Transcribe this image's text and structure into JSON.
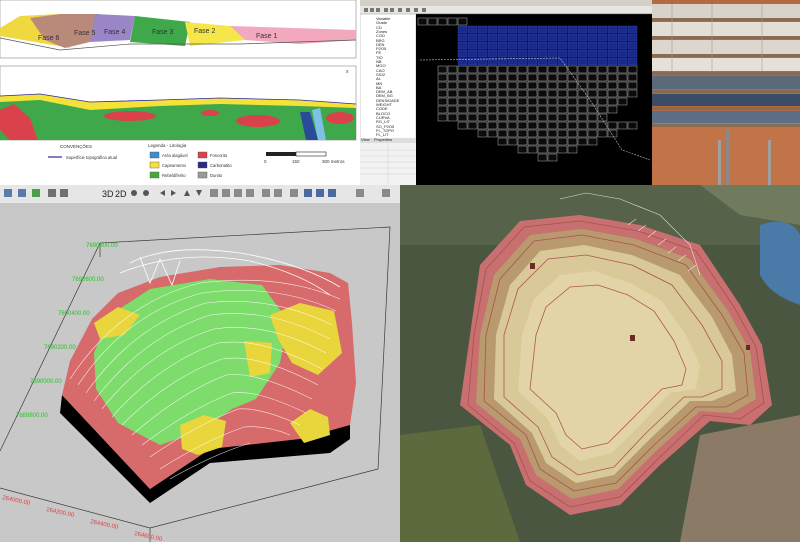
{
  "sections": {
    "phases": [
      "Fase 6",
      "Fase 5",
      "Fase 4",
      "Fase 3",
      "Fase 2",
      "Fase 1"
    ],
    "legend_title": "Legenda - Litologia",
    "conventions_title": "CONVENÇÕES",
    "surface_label": "Superfície topográfica atual",
    "lithology": [
      {
        "label": "Aréa alagável",
        "color": "#3a8fd0"
      },
      {
        "label": "Capeamento",
        "color": "#f4e23a"
      },
      {
        "label": "Rebeldíferito",
        "color": "#47a83c"
      },
      {
        "label": "Foscorito",
        "color": "#d9424a"
      },
      {
        "label": "Carbonatito",
        "color": "#2a2a8a"
      },
      {
        "label": "Dunito",
        "color": "#9a9a9a"
      }
    ],
    "scale": {
      "zero": "0",
      "mid": "150",
      "end": "300 metros"
    },
    "close_mark": "x"
  },
  "block_model": {
    "window": "block-model-software",
    "tree_items": [
      "Variable",
      "Grade",
      "CD",
      "Zones",
      "COD",
      "BRG",
      "DEN",
      "P2O5",
      "FE",
      "TIO",
      "NB",
      "MGO",
      "CAO",
      "SIO2",
      "AL",
      "MN",
      "BA",
      "DEM_AB",
      "DEM_BG",
      "DENSIDADE",
      "WEIGHT",
      "CODE",
      "BLOCO",
      "CURVA",
      "RG_LIT",
      "SO_P2O5",
      "FL_TOPO",
      "FL_LIT"
    ],
    "footer_tabs": [
      "View",
      "Properties"
    ]
  },
  "viewer3d": {
    "toolbar": [
      "3D",
      "2D"
    ],
    "coordinates_red": [
      "264000.00",
      "264200.00",
      "264400.00",
      "264600.00",
      "264800.00"
    ],
    "coordinates_green": [
      "7690800.00",
      "7690600.00",
      "7690400.00",
      "7690200.00",
      "7690000.00",
      "7689800.00"
    ]
  },
  "colors": {
    "fase6": "#f0d840",
    "fase5": "#b98a7a",
    "fase4": "#9a86c6",
    "fase3": "#3fa84a",
    "fase2": "#f5e64a",
    "fase1": "#f2a9bd",
    "capeamento": "#f4e23a",
    "rebeldiferito": "#47a83c",
    "foscorito": "#d9424a",
    "pit_red": "#d76a6a",
    "pit_green": "#7ddc6b",
    "pit_yellow": "#e9d53c"
  }
}
